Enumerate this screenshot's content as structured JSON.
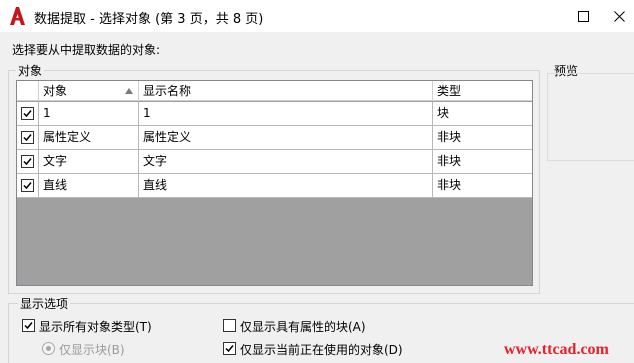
{
  "window": {
    "title": "数据提取 - 选择对象 (第 3 页，共 8 页)",
    "app_icon": "autocad-a-icon",
    "accent_color": "#c4161c"
  },
  "prompt": "选择要从中提取数据的对象:",
  "objects_group": {
    "legend": "对象",
    "columns": [
      "对象",
      "显示名称",
      "类型"
    ],
    "rows": [
      {
        "checked": true,
        "object": "1",
        "display_name": "1",
        "type": "块"
      },
      {
        "checked": true,
        "object": "属性定义",
        "display_name": "属性定义",
        "type": "非块"
      },
      {
        "checked": true,
        "object": "文字",
        "display_name": "文字",
        "type": "非块"
      },
      {
        "checked": true,
        "object": "直线",
        "display_name": "直线",
        "type": "非块"
      }
    ]
  },
  "preview": {
    "legend": "预览"
  },
  "display_options": {
    "legend": "显示选项",
    "show_all_types": {
      "label": "显示所有对象类型(T)",
      "checked": true
    },
    "blocks_only": {
      "label": "仅显示块(B)",
      "enabled": false
    },
    "only_with_attributes": {
      "label": "仅显示具有属性的块(A)",
      "checked": false
    },
    "only_in_use": {
      "label": "仅显示当前正在使用的对象(D)",
      "checked": true
    }
  },
  "watermark": "www.ttcad.com"
}
